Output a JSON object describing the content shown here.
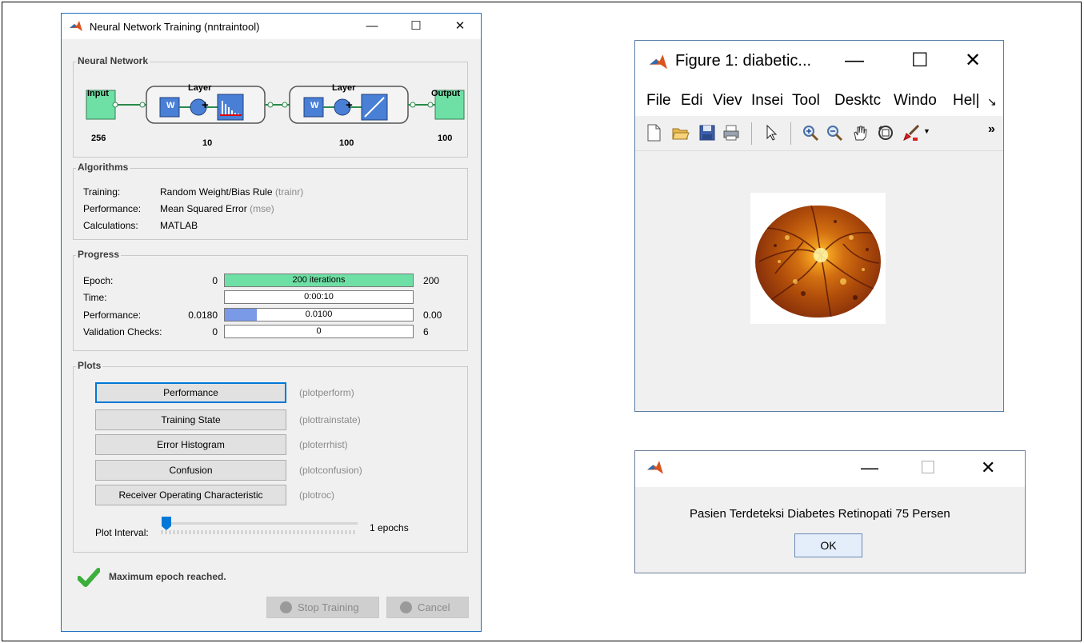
{
  "nntraintool": {
    "title": "Neural Network Training (nntraintool)",
    "window_buttons": {
      "minimize": "—",
      "maximize": "☐",
      "close": "✕"
    },
    "network": {
      "section_title": "Neural Network",
      "input_label": "Input",
      "input_size": "256",
      "hidden_layer_label": "Layer",
      "hidden_size": "10",
      "output_layer_label": "Layer",
      "output_layer_size": "100",
      "output_label": "Output",
      "output_size": "100",
      "weight_symbol": "W",
      "sum_symbol": "+"
    },
    "algorithms": {
      "section_title": "Algorithms",
      "rows": [
        {
          "label": "Training:",
          "value": "Random Weight/Bias Rule",
          "code": "(trainr)"
        },
        {
          "label": "Performance:",
          "value": "Mean Squared Error",
          "code": "(mse)"
        },
        {
          "label": "Calculations:",
          "value": "MATLAB",
          "code": ""
        }
      ]
    },
    "progress": {
      "section_title": "Progress",
      "rows": [
        {
          "label": "Epoch:",
          "start": "0",
          "bar_text": "200 iterations",
          "end": "200",
          "fill": 1.0
        },
        {
          "label": "Time:",
          "start": "",
          "bar_text": "0:00:10",
          "end": "",
          "fill": 0.0
        },
        {
          "label": "Performance:",
          "start": "0.0180",
          "bar_text": "0.0100",
          "end": "0.00",
          "fill": 0.17
        },
        {
          "label": "Validation Checks:",
          "start": "0",
          "bar_text": "0",
          "end": "6",
          "fill": 0.0
        }
      ]
    },
    "plots": {
      "section_title": "Plots",
      "buttons": [
        {
          "label": "Performance",
          "fn": "(plotperform)"
        },
        {
          "label": "Training State",
          "fn": "(plottrainstate)"
        },
        {
          "label": "Error Histogram",
          "fn": "(ploterrhist)"
        },
        {
          "label": "Confusion",
          "fn": "(plotconfusion)"
        },
        {
          "label": "Receiver Operating Characteristic",
          "fn": "(plotroc)"
        }
      ],
      "interval_label": "Plot Interval:",
      "interval_value": "1 epochs"
    },
    "status": "Maximum epoch reached.",
    "stop_button": "Stop Training",
    "cancel_button": "Cancel",
    "colors": {
      "green": "#6fe0a5",
      "blue": "#7a99e6",
      "block": "#4a7fd6"
    }
  },
  "figure": {
    "title": "Figure 1: diabetic...",
    "window_buttons": {
      "minimize": "—",
      "maximize": "☐",
      "close": "✕"
    },
    "menu": [
      "File",
      "Edi",
      "Viev",
      "Insei",
      "Tool",
      "Desktc",
      "Windo",
      "Hel|"
    ],
    "menu_overflow": "↘",
    "toolbar_overflow": "»"
  },
  "dialog": {
    "window_buttons": {
      "minimize": "—",
      "maximize": "☐",
      "close": "✕"
    },
    "message": "Pasien Terdeteksi Diabetes Retinopati 75 Persen",
    "ok_label": "OK"
  }
}
